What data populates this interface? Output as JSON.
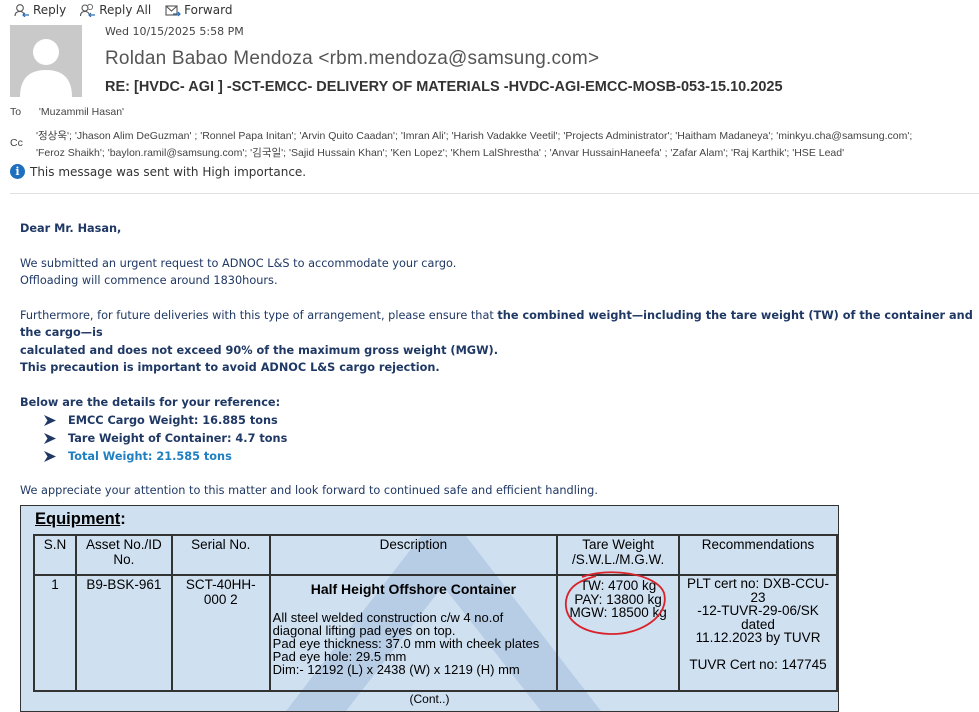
{
  "toolbar": {
    "reply_label": "Reply",
    "reply_all_label": "Reply All",
    "forward_label": "Forward",
    "reply_icon": "reply-icon",
    "reply_all_icon": "reply-all-icon",
    "forward_icon": "forward-icon"
  },
  "message": {
    "date": "Wed 10/15/2025 5:58 PM",
    "sender": "Roldan Babao Mendoza <rbm.mendoza@samsung.com>",
    "subject": "RE: [HVDC- AGI ] -SCT-EMCC- DELIVERY OF MATERIALS -HVDC-AGI-EMCC-MOSB-053-15.10.2025",
    "to_label": "To",
    "to_value": "'Muzammil Hasan'",
    "cc_label": "Cc",
    "cc_line1": "'정상욱'; 'Jhason Alim DeGuzman'    ; 'Ronnel Papa Initan'; 'Arvin Quito Caadan'; 'Imran Ali'; 'Harish Vadakke Veetil'; 'Projects Administrator'; 'Haitham Madaneya'; 'minkyu.cha@samsung.com';",
    "cc_line2": "'Feroz Shaikh'; 'baylon.ramil@samsung.com'; '김국일'; 'Sajid Hussain Khan'; 'Ken Lopez'; 'Khem LalShrestha'    ; 'Anvar HussainHaneefa'    ; 'Zafar Alam'; 'Raj Karthik'; 'HSE Lead'",
    "importance": "This message was sent with High importance."
  },
  "body": {
    "greeting": "Dear Mr. Hasan,",
    "p1_line1": "We submitted an urgent request to ADNOC L&S to accommodate your cargo.",
    "p1_line2": "Offloading will commence around 1830hours.",
    "p2_prefix": "Furthermore, for future deliveries with this type of arrangement, please ensure that ",
    "p2_bold_a": "the combined weight—including the tare weight (TW) of the container and the cargo—is",
    "p2_bold_b": "calculated and does not exceed 90% of the maximum gross weight (MGW).",
    "p2_bold_c": "This precaution is important to avoid ADNOC L&S cargo rejection.",
    "details_heading": "Below are the details for your reference:",
    "bullets": [
      "EMCC Cargo Weight: 16.885 tons",
      "Tare Weight of Container: 4.7 tons",
      "Total Weight: 21.585 tons"
    ],
    "closing": "We appreciate your attention to this matter and look forward to continued safe and efficient handling."
  },
  "equipment": {
    "title": "Equipment",
    "title_suffix": ":",
    "headers": [
      "S.N",
      "Asset No./ID No.",
      "Serial No.",
      "Description",
      "Tare Weight /S.W.L./M.G.W.",
      "Recommendations"
    ],
    "row": {
      "sn": "1",
      "asset": "B9-BSK-961",
      "serial": "SCT-40HH-000 2",
      "desc_title": "Half Height Offshore Container",
      "desc_l1": "All steel welded construction c/w 4 no.of",
      "desc_l2": "diagonal lifting pad eyes on top.",
      "desc_l3": "Pad eye thickness: 37.0 mm with cheek plates",
      "desc_l4": "Pad eye hole: 29.5 mm",
      "desc_l5": "Dim:- 12192 (L) x 2438 (W) x 1219 (H) mm",
      "tw": "TW: 4700 kg",
      "pay": "PAY: 13800 kg",
      "mgw": "MGW: 18500 kg",
      "reco_l1": "PLT cert no: DXB-CCU-23",
      "reco_l2": "-12-TUVR-29-06/SK dated",
      "reco_l3": "11.12.2023 by TUVR",
      "reco_l4": "TUVR Cert no: 147745"
    },
    "cont": "(Cont..)"
  },
  "colors": {
    "body_text": "#1f3864",
    "bullet_blue": "#1f7fc1",
    "table_bg": "#cfe0f1",
    "annotation_red": "#d9232a"
  }
}
